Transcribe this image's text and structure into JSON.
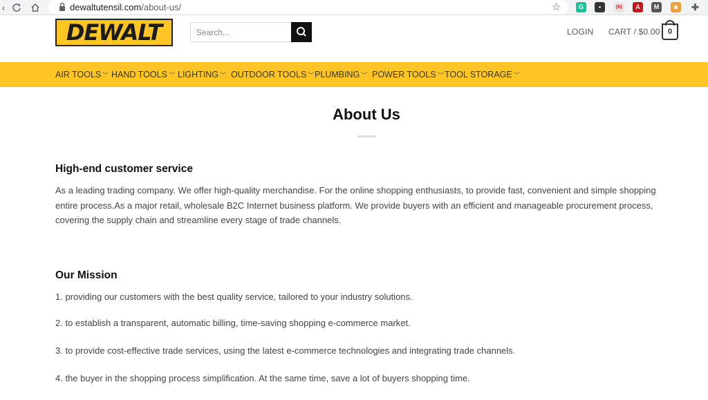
{
  "browser": {
    "url_domain": "dewaltutensil.com",
    "url_path": "/about-us/",
    "extensions": [
      {
        "name": "grammarly-icon",
        "color": "#15c39a",
        "glyph": "G"
      },
      {
        "name": "trello-icon",
        "color": "#333333",
        "glyph": "▪"
      },
      {
        "name": "ext-red-icon",
        "color": "#e8e8e8",
        "glyph": "(h)"
      },
      {
        "name": "pdf-icon",
        "color": "#c4161c",
        "glyph": "A"
      },
      {
        "name": "gmail-icon",
        "color": "#555555",
        "glyph": "M"
      },
      {
        "name": "photo-icon",
        "color": "#e9a23b",
        "glyph": "◙"
      },
      {
        "name": "puzzle-icon",
        "color": "#5f6368",
        "glyph": "✚"
      }
    ]
  },
  "header": {
    "logo_text": "DEWALT",
    "search_placeholder": "Search...",
    "login_label": "LOGIN",
    "cart_label": "CART / $0.00",
    "cart_count": "0"
  },
  "nav": {
    "items": [
      {
        "label": "AIR TOOLS"
      },
      {
        "label": "HAND TOOLS"
      },
      {
        "label": "LIGHTING"
      },
      {
        "label": "OUTDOOR TOOLS"
      },
      {
        "label": "PLUMBING"
      },
      {
        "label": "POWER TOOLS"
      },
      {
        "label": "TOOL STORAGE"
      }
    ]
  },
  "content": {
    "title": "About Us",
    "section1_heading": "High-end customer service",
    "section1_text": "As a leading trading company. We offer high-quality merchandise. For the online shopping enthusiasts, to provide fast, convenient and simple shopping entire process.As a major retail, wholesale B2C Internet business platform. We provide buyers with an efficient and manageable procurement process, covering the supply chain and streamline every stage of trade channels.",
    "section2_heading": "Our Mission",
    "mission_items": [
      "1. providing our customers with the best quality service, tailored to your industry solutions.",
      "2. to establish a transparent, automatic billing, time-saving shopping e-commerce market.",
      "3. to provide cost-effective trade services, using the latest e-commerce technologies and integrating trade channels.",
      "4. the buyer in the shopping process simplification. At the same time, save a lot of buyers shopping time."
    ]
  },
  "colors": {
    "brand_yellow": "#fec524",
    "dark": "#111111"
  }
}
